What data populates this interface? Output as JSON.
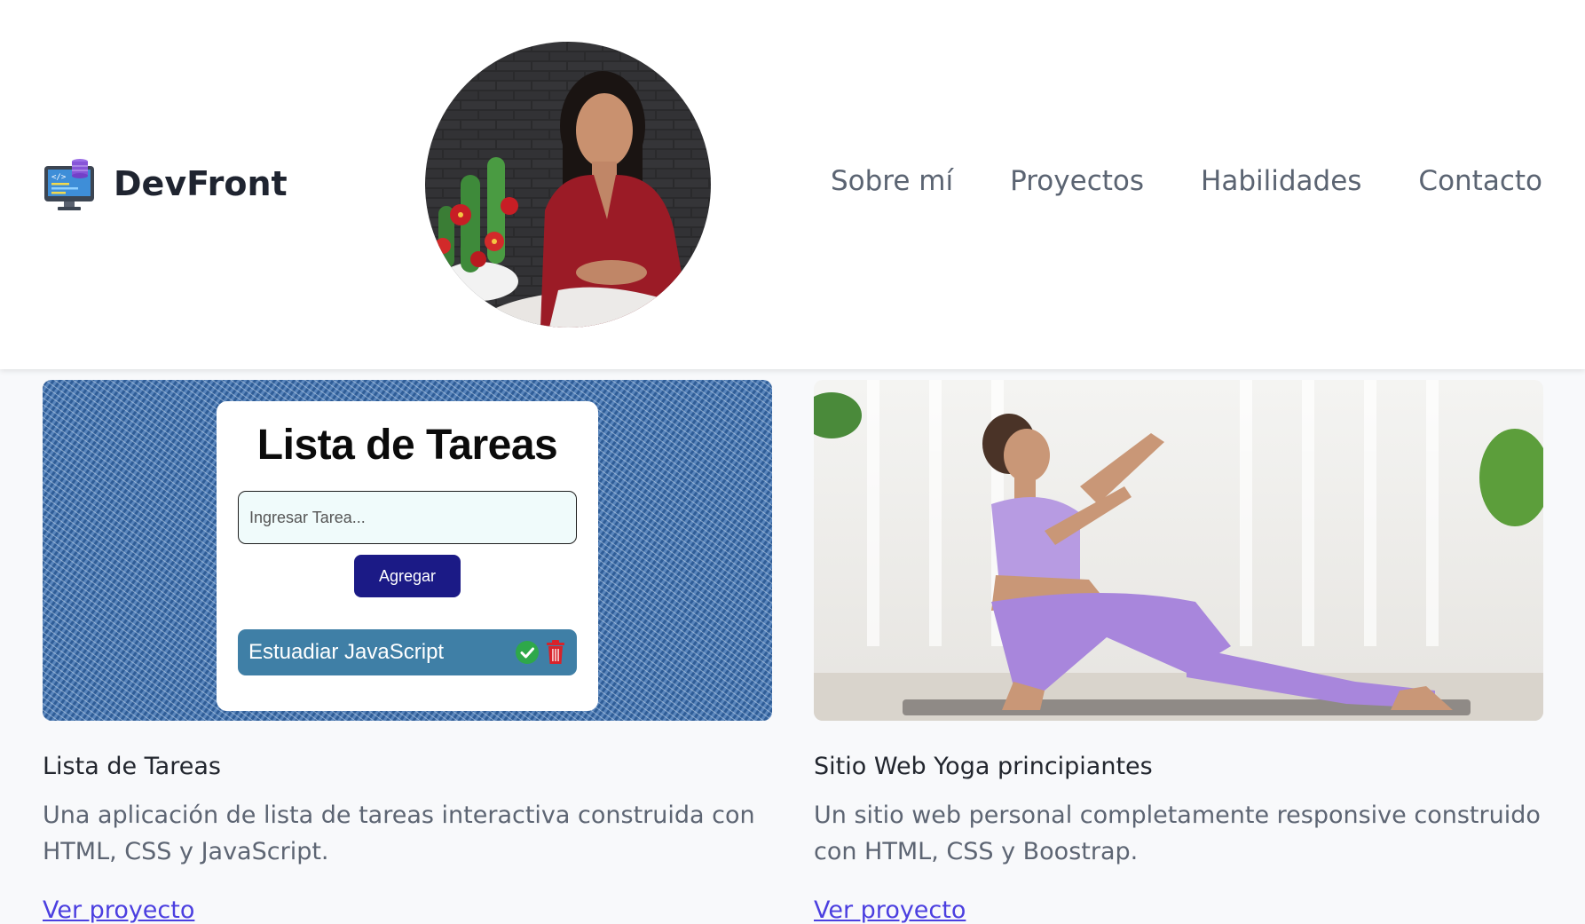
{
  "header": {
    "brand_name": "DevFront",
    "brand_icon": "computer-monitor-icon",
    "avatar": "profile-photo",
    "nav": [
      {
        "label": "Sobre mí"
      },
      {
        "label": "Proyectos"
      },
      {
        "label": "Habilidades"
      },
      {
        "label": "Contacto"
      }
    ]
  },
  "projects": [
    {
      "title": "Lista de Tareas",
      "description": "Una aplicación de lista de tareas interactiva construida con HTML, CSS y JavaScript.",
      "link_label": "Ver proyecto",
      "preview": {
        "heading": "Lista de Tareas",
        "input_placeholder": "Ingresar Tarea...",
        "button_label": "Agregar",
        "task_text": "Estuadiar JavaScript"
      }
    },
    {
      "title": "Sitio Web Yoga principiantes",
      "description": "Un sitio web personal completamente responsive construido con HTML, CSS y Boostrap.",
      "link_label": "Ver proyecto"
    }
  ],
  "colors": {
    "header_bg": "#ffffff",
    "page_bg": "#f8f9fb",
    "nav_text": "#5b6472",
    "link": "#4b3fe0",
    "todo_button": "#1b1a86",
    "todo_item": "#3f7fa6"
  }
}
